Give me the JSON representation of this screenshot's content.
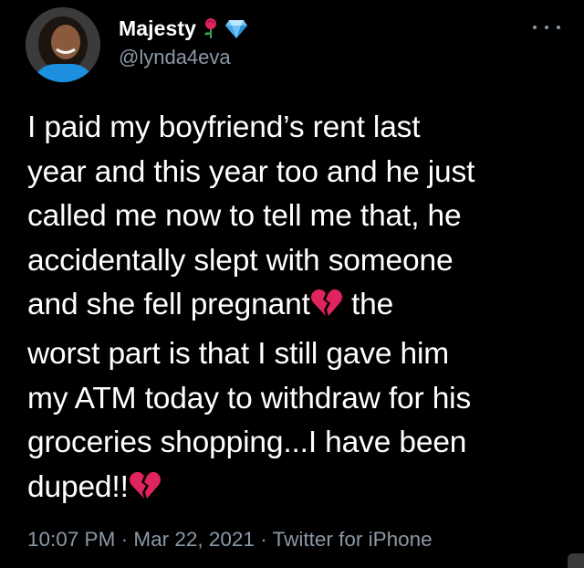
{
  "user": {
    "display_name": "Majesty",
    "handle": "@lynda4eva",
    "name_emojis": [
      "rose-icon",
      "gem-icon"
    ]
  },
  "tweet": {
    "lines": [
      "I paid my boyfriend’s rent last",
      "year and this year too and he just",
      "called me now to tell me that, he",
      "accidentally slept with someone",
      "and she fell pregnant",
      "the",
      "worst part is that I still gave him",
      "my ATM today to withdraw for his",
      "groceries shopping...I have been",
      "duped!!"
    ],
    "inline_emoji": "broken-heart-icon"
  },
  "meta": {
    "time": "10:07 PM",
    "date": "Mar 22, 2021",
    "source": "Twitter for iPhone",
    "separator": "·"
  },
  "colors": {
    "background": "#000000",
    "text": "#ffffff",
    "secondary": "#8b98a5",
    "heart": "#e0245e"
  }
}
